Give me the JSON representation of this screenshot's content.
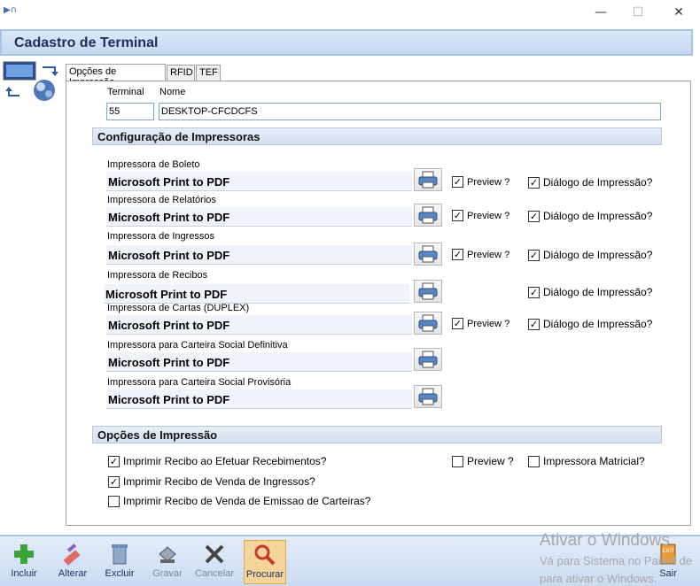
{
  "window": {
    "minimize": "—",
    "maximize": "☐",
    "close": "✕"
  },
  "header": {
    "title": "Cadastro de Terminal"
  },
  "tabs": [
    {
      "label": "Opções de Impressão"
    },
    {
      "label": "RFID"
    },
    {
      "label": "TEF"
    }
  ],
  "terminal": {
    "terminal_label": "Terminal",
    "terminal_value": "55",
    "name_label": "Nome",
    "name_value": "DESKTOP-CFCDCFS"
  },
  "printers_section": {
    "title": "Configuração de Impressoras"
  },
  "printers": [
    {
      "label": "Impressora de Boleto",
      "value": "Microsoft Print to PDF",
      "preview_label": "Preview ?",
      "preview_checked": true,
      "dialog_label": "Diálogo de Impressão?",
      "dialog_checked": true
    },
    {
      "label": "Impressora de Relatórios",
      "value": "Microsoft Print to PDF",
      "preview_label": "Preview ?",
      "preview_checked": true,
      "dialog_label": "Diálogo de Impressão?",
      "dialog_checked": true
    },
    {
      "label": "Impressora de Ingressos",
      "value": "Microsoft Print to PDF",
      "preview_label": "Preview ?",
      "preview_checked": true,
      "dialog_label": "Diálogo de Impressão?",
      "dialog_checked": true
    },
    {
      "label": "Impressora de Recibos",
      "value": "Microsoft Print to PDF",
      "dialog_label": "Diálogo de Impressão?",
      "dialog_checked": true
    },
    {
      "label": "Impressora de Cartas (DUPLEX)",
      "value": "Microsoft Print to PDF",
      "preview_label": "Preview ?",
      "preview_checked": true,
      "dialog_label": "Diálogo de Impressão?",
      "dialog_checked": true
    },
    {
      "label": "Impressora para Carteira Social Definitiva",
      "value": "Microsoft Print to PDF"
    },
    {
      "label": "Impressora para Carteira Social Provisória",
      "value": "Microsoft Print to PDF"
    }
  ],
  "options_section": {
    "title": "Opções de Impressão"
  },
  "options": {
    "print_receipt_payments": {
      "label": "Imprimir Recibo ao Efetuar Recebimentos?",
      "checked": true
    },
    "print_receipt_tickets": {
      "label": "Imprimir Recibo de Venda de Ingressos?",
      "checked": true
    },
    "print_receipt_cards": {
      "label": "Imprimir Recibo de Venda de Emissao de Carteiras?",
      "checked": false
    },
    "preview": {
      "label": "Preview ?",
      "checked": false
    },
    "matrix_printer": {
      "label": "Impressora Matricial?",
      "checked": false
    }
  },
  "toolbar": {
    "incluir": "Incluir",
    "alterar": "Alterar",
    "excluir": "Excluir",
    "gravar": "Gravar",
    "cancelar": "Cancelar",
    "procurar": "Procurar",
    "sair": "Sair",
    "exit_badge": "EXIT"
  },
  "watermark": {
    "line1": "Ativar o Windows",
    "line2": "Vá para Sistema no Painel de",
    "line3": "para ativar o Windows."
  }
}
